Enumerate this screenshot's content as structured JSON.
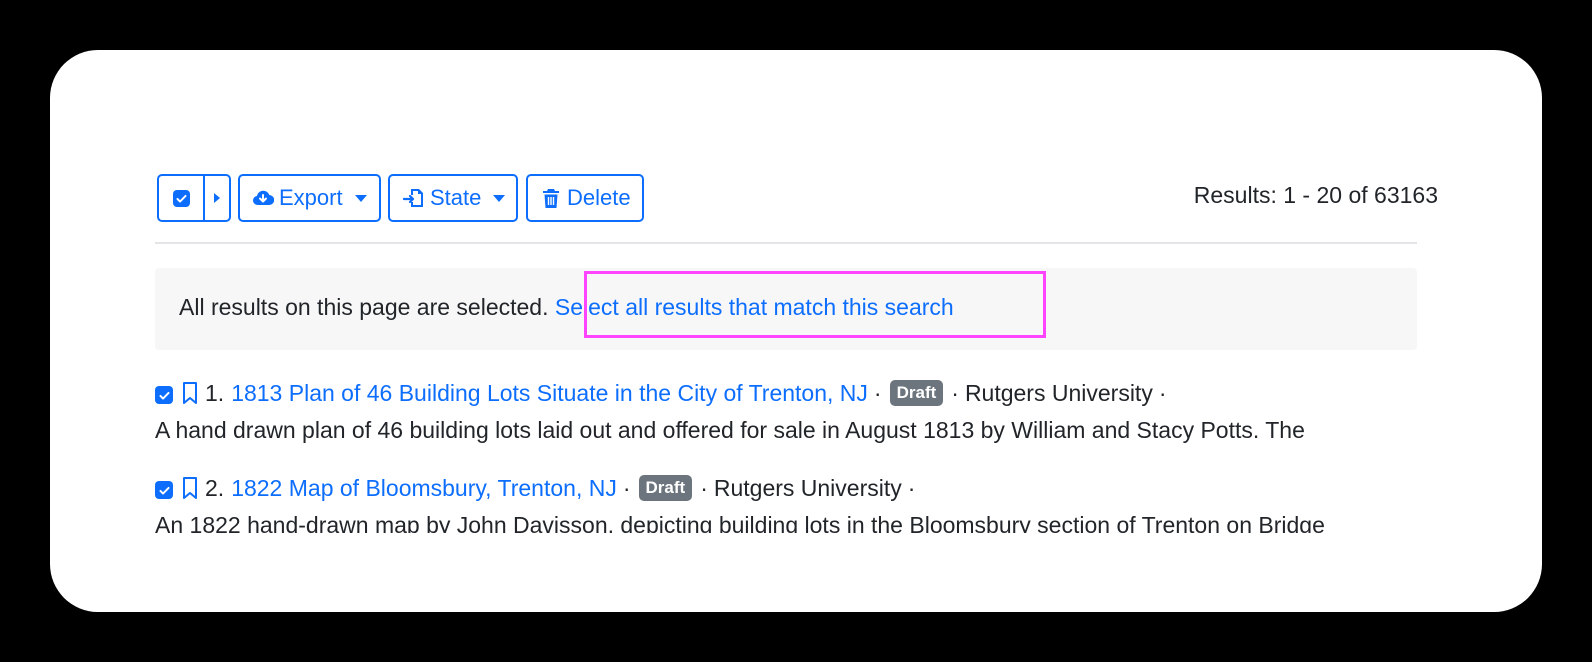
{
  "toolbar": {
    "export_label": "Export",
    "state_label": "State",
    "delete_label": "Delete"
  },
  "results_summary": "Results: 1 - 20 of 63163",
  "selection_notice": {
    "text": "All results on this page are selected.",
    "link": "Select all results that match this search"
  },
  "documents": [
    {
      "number": "1.",
      "title": "1813 Plan of 46 Building Lots Situate in the City of Trenton, NJ",
      "badge": "Draft",
      "institution": "Rutgers University",
      "description": "A hand drawn plan of 46 building lots laid out and offered for sale in August 1813 by William and Stacy Potts. The"
    },
    {
      "number": "2.",
      "title": "1822 Map of Bloomsbury, Trenton, NJ",
      "badge": "Draft",
      "institution": "Rutgers University",
      "description": "An 1822 hand-drawn map by John Davisson, depicting building lots in the Bloomsbury section of Trenton on Bridge"
    }
  ],
  "separator": "·",
  "colors": {
    "accent": "#0d6efd",
    "badge": "#6c757d",
    "highlight": "#ff44ff",
    "notice_bg": "#f7f7f8"
  },
  "icons": [
    "check-icon",
    "caret-right-icon",
    "cloud-download-icon",
    "caret-down-icon",
    "file-import-icon",
    "trash-icon",
    "bookmark-icon"
  ]
}
